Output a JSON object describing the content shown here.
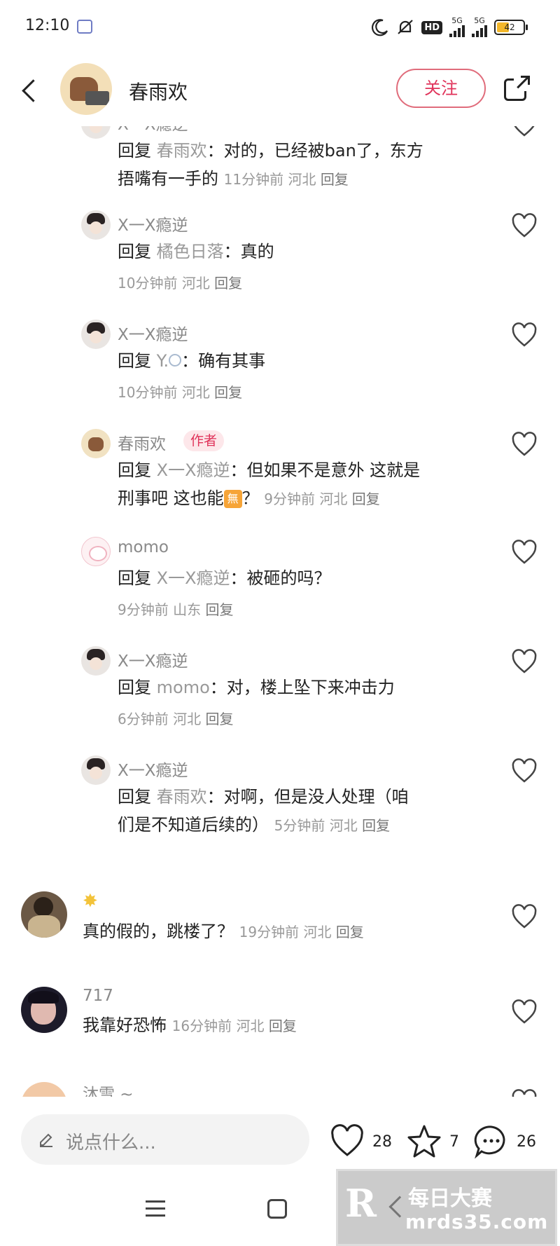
{
  "status_bar": {
    "time": "12:10",
    "hd": "HD",
    "net1": "5G",
    "net2": "5G",
    "battery": "42"
  },
  "header": {
    "user_name": "春雨欢",
    "follow_label": "关注"
  },
  "comments": [
    {
      "author": "X一X瘾逆",
      "prefix": "回复 ",
      "reply_to": "春雨欢",
      "text": "：对的，已经被ban了，东方",
      "text2": "捂嘴有一手的",
      "time": "11分钟前",
      "location": "河北",
      "reply": "回复"
    },
    {
      "author": "X一X瘾逆",
      "prefix": "回复 ",
      "reply_to": "橘色日落",
      "text": "：真的",
      "time": "10分钟前",
      "location": "河北",
      "reply": "回复"
    },
    {
      "author": "X一X瘾逆",
      "prefix": "回复 ",
      "reply_to": "Y.",
      "text": "：确有其事",
      "time": "10分钟前",
      "location": "河北",
      "reply": "回复"
    },
    {
      "author": "春雨欢",
      "badge": "作者",
      "prefix": "回复 ",
      "reply_to": "X一X瘾逆",
      "text": "：但如果不是意外 这就是",
      "text2": "刑事吧 这也能",
      "emoji": "無",
      "text3": "？",
      "time": "9分钟前",
      "location": "河北",
      "reply": "回复"
    },
    {
      "author": "momo",
      "prefix": "回复 ",
      "reply_to": "X一X瘾逆",
      "text": "：被砸的吗？",
      "time": "9分钟前",
      "location": "山东",
      "reply": "回复"
    },
    {
      "author": "X一X瘾逆",
      "prefix": "回复 ",
      "reply_to": "momo",
      "text": "：对，楼上坠下来冲击力",
      "time": "6分钟前",
      "location": "河北",
      "reply": "回复"
    },
    {
      "author": "X一X瘾逆",
      "prefix": "回复 ",
      "reply_to": "春雨欢",
      "text": "：对啊，但是没人处理（咱",
      "text2": "们是不知道后续的）",
      "time": "5分钟前",
      "location": "河北",
      "reply": "回复"
    },
    {
      "text": "真的假的，跳楼了？",
      "time": "19分钟前",
      "location": "河北",
      "reply": "回复"
    },
    {
      "author": "717",
      "text": "我靠好恐怖",
      "time": "16分钟前",
      "location": "河北",
      "reply": "回复"
    },
    {
      "author": "沐雪 ~"
    }
  ],
  "bottom_bar": {
    "input_placeholder": "说点什么...",
    "likes": "28",
    "favorites": "7",
    "comments": "26"
  },
  "watermark": {
    "logo": "R",
    "line1": "每日大赛",
    "line2": "mrds35.com"
  },
  "colors": {
    "accent": "#e0335a",
    "text": "#222222",
    "secondary": "#999999"
  }
}
